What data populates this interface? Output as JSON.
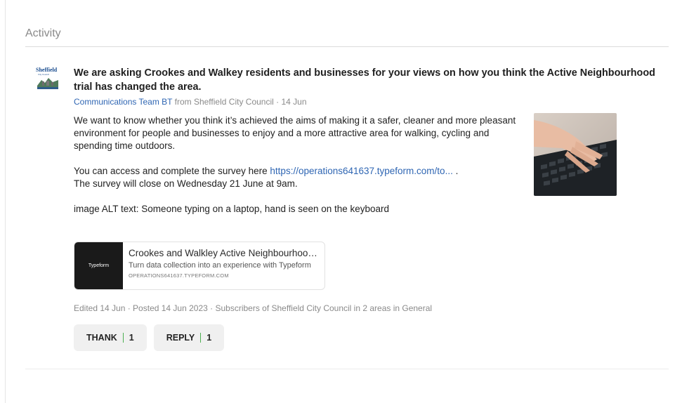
{
  "section": {
    "title": "Activity"
  },
  "post": {
    "avatar": {
      "name": "Sheffield",
      "subtitle": "City Council"
    },
    "title": "We are asking Crookes and Walkey residents and businesses for your views on how you think the Active Neighbourhood trial has changed the area.",
    "meta": {
      "author": "Communications Team BT",
      "from_text": "from Sheffield City Council · 14 Jun"
    },
    "paragraph1": "We want to know whether you think it’s achieved the aims of making it a safer, cleaner and more pleasant environment for people and businesses to enjoy and a more attractive area for walking, cycling and spending time outdoors.",
    "paragraph2_prefix": "You can access and complete the survey here ",
    "survey_link": "https://operations641637.typeform.com/to...",
    "paragraph2_suffix": " .",
    "paragraph2_line2": "The survey will close on Wednesday 21 June at 9am.",
    "alt_text": "image ALT text: Someone typing on a laptop, hand is seen on the keyboard",
    "image": {
      "icon": "laptop-typing-photo"
    },
    "link_card": {
      "logo_text": "Typeform",
      "title": "Crookes and Walkley Active Neighbourhood trial survey",
      "description": "Turn data collection into an experience with Typeform",
      "domain": "OPERATIONS641637.TYPEFORM.COM"
    },
    "footer": "Edited 14 Jun · Posted 14 Jun 2023 · Subscribers of Sheffield City Council in 2 areas in General",
    "actions": {
      "thank": {
        "label": "THANK",
        "count": "1"
      },
      "reply": {
        "label": "REPLY",
        "count": "1"
      }
    }
  },
  "colors": {
    "link": "#2f66b3",
    "muted": "#8a8a8a",
    "count_separator": "#4caf50"
  }
}
